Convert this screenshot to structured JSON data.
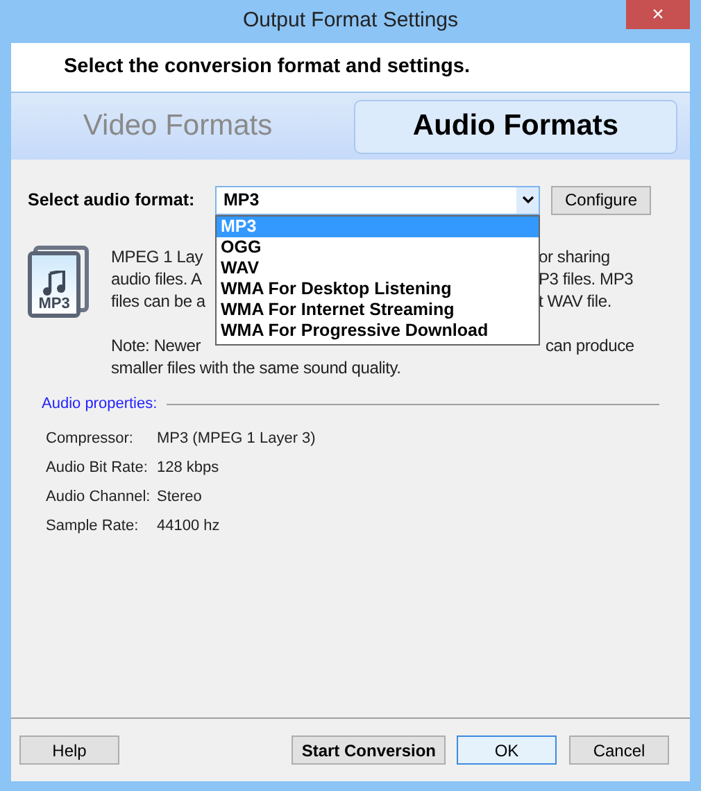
{
  "window": {
    "title": "Output Format Settings",
    "close": "×"
  },
  "header": "Select the conversion format and settings.",
  "tabs": [
    {
      "label": "Video Formats",
      "selected": false
    },
    {
      "label": "Audio Formats",
      "selected": true
    }
  ],
  "format_select": {
    "label": "Select audio format:",
    "value": "MP3",
    "expanded": true,
    "options": [
      {
        "label": "MP3",
        "selected": true
      },
      {
        "label": "OGG",
        "selected": false
      },
      {
        "label": "WAV",
        "selected": false
      },
      {
        "label": "WMA For Desktop Listening",
        "selected": false
      },
      {
        "label": "WMA For Internet Streaming",
        "selected": false
      },
      {
        "label": "WMA For Progressive Download",
        "selected": false
      }
    ]
  },
  "configure_button": "Configure",
  "format_icon": {
    "label": "MP3"
  },
  "description": [
    {
      "left": "MPEG 1 Lay",
      "right": "or sharing"
    },
    {
      "left": "audio files. A",
      "right": "P3 files.  MP3"
    },
    {
      "left": "files can be a",
      "right": "t WAV file."
    }
  ],
  "note": [
    {
      "left": "Note: Newer",
      "right": "can produce"
    },
    {
      "left": "smaller files with the same sound quality."
    }
  ],
  "audio_properties": {
    "title": "Audio properties:",
    "rows": [
      {
        "label": "Compressor:",
        "value": "MP3 (MPEG 1 Layer 3)"
      },
      {
        "label": "Audio Bit Rate:",
        "value": "128 kbps"
      },
      {
        "label": "Audio Channel:",
        "value": "Stereo"
      },
      {
        "label": "Sample Rate:",
        "value": "44100 hz"
      }
    ]
  },
  "buttons": [
    {
      "label": "Help",
      "kind": "plain"
    },
    {
      "label": "Start Conversion",
      "kind": "bold"
    },
    {
      "label": "OK",
      "kind": "default"
    },
    {
      "label": "Cancel",
      "kind": "plain"
    }
  ]
}
